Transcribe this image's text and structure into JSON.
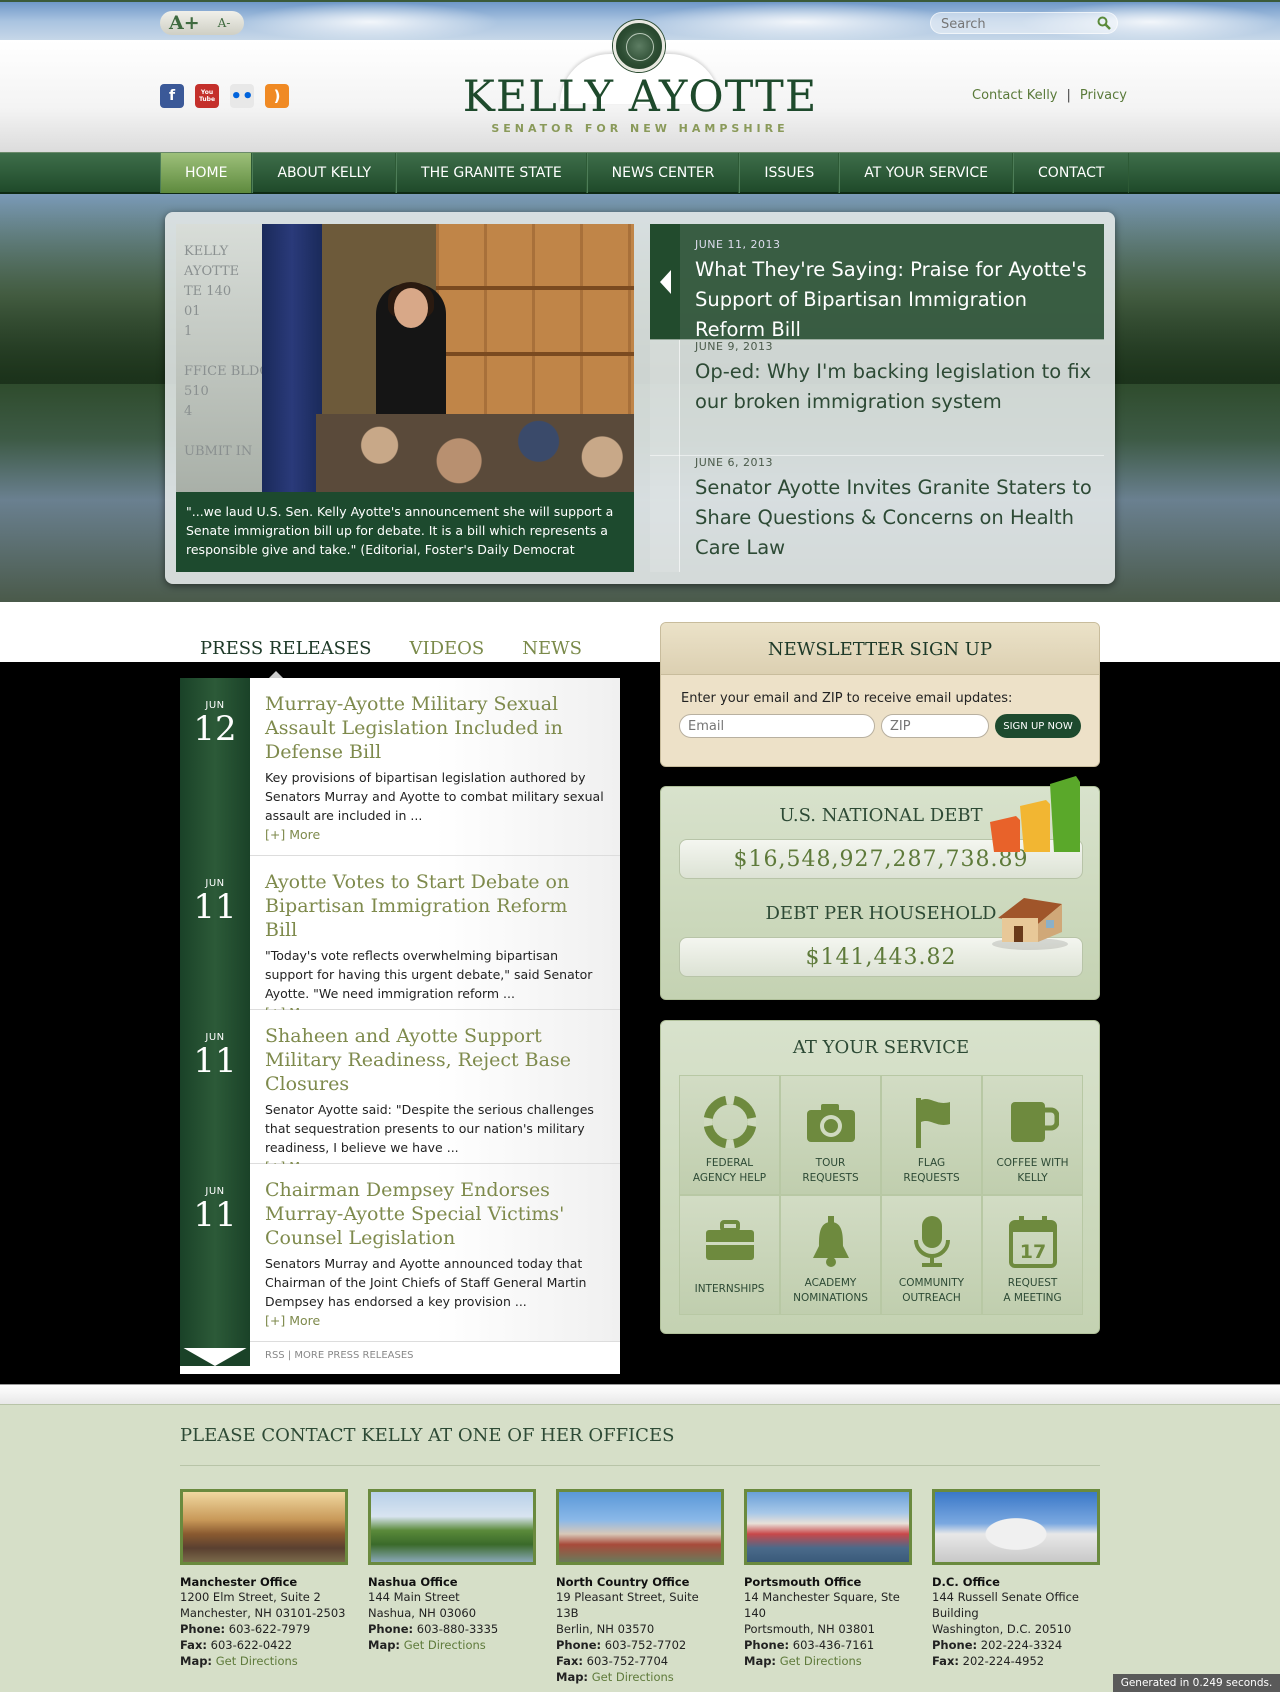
{
  "font_size": {
    "increase": "A+",
    "decrease": "A-"
  },
  "search": {
    "placeholder": "Search"
  },
  "brand": {
    "title": "KELLY AYOTTE",
    "subtitle": "SENATOR FOR NEW HAMPSHIRE"
  },
  "social": [
    {
      "name": "facebook",
      "glyph": "f",
      "color": "#3b5998"
    },
    {
      "name": "youtube",
      "glyph": "You Tube",
      "color": "#c4302b"
    },
    {
      "name": "flickr",
      "glyph": "••",
      "color": "#e8e8e8"
    },
    {
      "name": "rss",
      "glyph": ")",
      "color": "#f08a24"
    }
  ],
  "top_links": {
    "contact": "Contact Kelly",
    "separator": "|",
    "privacy": "Privacy"
  },
  "nav": {
    "items": [
      "HOME",
      "ABOUT KELLY",
      "THE GRANITE STATE",
      "NEWS CENTER",
      "ISSUES",
      "AT YOUR SERVICE",
      "CONTACT"
    ],
    "active": "HOME"
  },
  "hero": {
    "wall_text": [
      "KELLY",
      "AYOTTE",
      "TE 140",
      "01",
      "1",
      "",
      "FFICE BLDG.",
      "510",
      "4",
      "",
      "UBMIT IN"
    ],
    "caption": "\"...we laud U.S. Sen. Kelly Ayotte's announcement she will support a Senate immigration bill up for debate. It is a bill which represents a responsible give and take.\" (Editorial, Foster's Daily Democrat",
    "news": [
      {
        "date": "JUNE 11, 2013",
        "title": "What They're Saying: Praise for Ayotte's Support of Bipartisan Immigration Reform Bill",
        "active": true
      },
      {
        "date": "JUNE 9, 2013",
        "title": "Op-ed: Why I'm backing legislation to fix our broken immigration system",
        "active": false
      },
      {
        "date": "JUNE 6, 2013",
        "title": "Senator Ayotte Invites Granite Staters to Share Questions & Concerns on Health Care Law",
        "active": false
      }
    ]
  },
  "tabs": {
    "items": [
      "PRESS RELEASES",
      "VIDEOS",
      "NEWS"
    ],
    "active": "PRESS RELEASES"
  },
  "press": [
    {
      "month": "JUN",
      "day": "12",
      "title": "Murray-Ayotte Military Sexual Assault Legislation Included in Defense Bill",
      "excerpt": "Key provisions of bipartisan legislation authored by Senators Murray and Ayotte to combat military sexual assault are included in ...",
      "more": "[+] More"
    },
    {
      "month": "JUN",
      "day": "11",
      "title": "Ayotte Votes to Start Debate on Bipartisan Immigration Reform Bill",
      "excerpt": "\"Today's vote reflects overwhelming bipartisan support for having this urgent debate,\" said Senator Ayotte. \"We need immigration reform ...",
      "more": "[+] More"
    },
    {
      "month": "JUN",
      "day": "11",
      "title": "Shaheen and Ayotte Support Military Readiness, Reject Base Closures",
      "excerpt": "Senator Ayotte said: \"Despite the serious challenges that sequestration presents to our nation's military readiness, I believe we have ...",
      "more": "[+] More"
    },
    {
      "month": "JUN",
      "day": "11",
      "title": "Chairman Dempsey Endorses Murray-Ayotte Special Victims' Counsel Legislation",
      "excerpt": "Senators Murray and Ayotte announced today that Chairman of the Joint Chiefs of Staff General Martin Dempsey has endorsed a key provision ...",
      "more": "[+] More"
    }
  ],
  "press_links": {
    "rss": "RSS",
    "sep": "|",
    "more": "MORE PRESS RELEASES"
  },
  "newsletter": {
    "title": "NEWSLETTER SIGN UP",
    "text": "Enter your email and ZIP to receive email updates:",
    "email_placeholder": "Email",
    "zip_placeholder": "ZIP",
    "button": "SIGN UP NOW"
  },
  "debt": {
    "national_label": "U.S. NATIONAL DEBT",
    "national_value": "$16,548,927,287,738.89",
    "household_label": "DEBT PER HOUSEHOLD",
    "household_value": "$141,443.82"
  },
  "service": {
    "title": "AT YOUR SERVICE",
    "items": [
      {
        "label": "FEDERAL AGENCY HELP",
        "line1": "FEDERAL",
        "line2": "AGENCY HELP",
        "icon": "lifebuoy-icon"
      },
      {
        "label": "TOUR REQUESTS",
        "line1": "TOUR",
        "line2": "REQUESTS",
        "icon": "camera-icon"
      },
      {
        "label": "FLAG REQUESTS",
        "line1": "FLAG",
        "line2": "REQUESTS",
        "icon": "flag-icon"
      },
      {
        "label": "COFFEE WITH KELLY",
        "line1": "COFFEE WITH",
        "line2": "KELLY",
        "icon": "coffee-mug-icon"
      },
      {
        "label": "INTERNSHIPS",
        "line1": "INTERNSHIPS",
        "line2": "",
        "icon": "briefcase-icon"
      },
      {
        "label": "ACADEMY NOMINATIONS",
        "line1": "ACADEMY",
        "line2": "NOMINATIONS",
        "icon": "bell-icon"
      },
      {
        "label": "COMMUNITY OUTREACH",
        "line1": "COMMUNITY",
        "line2": "OUTREACH",
        "icon": "microphone-icon"
      },
      {
        "label": "REQUEST A MEETING",
        "line1": "REQUEST",
        "line2": "A MEETING",
        "icon": "calendar-icon",
        "calendar_day": "17"
      }
    ]
  },
  "footer": {
    "title": "PLEASE CONTACT KELLY AT ONE OF HER OFFICES",
    "offices": [
      {
        "name": "Manchester Office",
        "lines": [
          "1200 Elm Street, Suite 2",
          "Manchester, NH 03101-2503"
        ],
        "phone": "603-622-7979",
        "fax": "603-622-0422",
        "map": "Get Directions"
      },
      {
        "name": "Nashua Office",
        "lines": [
          "144 Main Street",
          "Nashua, NH 03060"
        ],
        "phone": "603-880-3335",
        "fax": "",
        "map": "Get Directions"
      },
      {
        "name": "North Country Office",
        "lines": [
          "19 Pleasant Street, Suite 13B",
          "Berlin, NH 03570"
        ],
        "phone": "603-752-7702",
        "fax": "603-752-7704",
        "map": "Get Directions"
      },
      {
        "name": "Portsmouth Office",
        "lines": [
          "14 Manchester Square, Ste 140",
          "Portsmouth, NH 03801"
        ],
        "phone": "603-436-7161",
        "fax": "",
        "map": "Get Directions"
      },
      {
        "name": "D.C. Office",
        "lines": [
          "144 Russell Senate Office",
          "Building",
          "Washington, D.C. 20510"
        ],
        "phone": "202-224-3324",
        "fax": "202-224-4952",
        "map": ""
      }
    ],
    "labels": {
      "phone": "Phone:",
      "fax": "Fax:",
      "map": "Map:"
    }
  },
  "generated": "Generated in 0.249 seconds."
}
